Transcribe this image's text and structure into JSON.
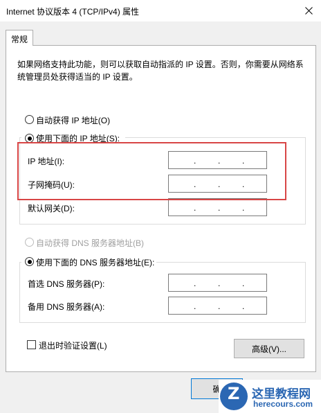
{
  "window": {
    "title": "Internet 协议版本 4 (TCP/IPv4) 属性"
  },
  "tabs": [
    {
      "label": "常规",
      "selected": true
    }
  ],
  "description": "如果网络支持此功能，则可以获取自动指派的 IP 设置。否则，你需要从网络系统管理员处获得适当的 IP 设置。",
  "ip_section": {
    "auto_option": {
      "label": "自动获得 IP 地址(O)",
      "selected": false
    },
    "manual_option": {
      "label": "使用下面的 IP 地址(S):",
      "selected": true
    },
    "fields": [
      {
        "label": "IP 地址(I):",
        "value": ". . ."
      },
      {
        "label": "子网掩码(U):",
        "value": ". . ."
      },
      {
        "label": "默认网关(D):",
        "value": ". . ."
      }
    ]
  },
  "dns_section": {
    "auto_option": {
      "label": "自动获得 DNS 服务器地址(B)",
      "selected": false,
      "disabled": true
    },
    "manual_option": {
      "label": "使用下面的 DNS 服务器地址(E):",
      "selected": true
    },
    "fields": [
      {
        "label": "首选 DNS 服务器(P):",
        "value": ". . ."
      },
      {
        "label": "备用 DNS 服务器(A):",
        "value": ". . ."
      }
    ]
  },
  "validate_checkbox": {
    "label": "退出时验证设置(L)",
    "checked": false
  },
  "buttons": {
    "advanced": "高级(V)...",
    "ok": "确"
  },
  "annotation": {
    "highlight_color": "#d84545"
  },
  "watermark": {
    "title": "这里教程网",
    "url": "herecours.com"
  },
  "colors": {
    "accent": "#0078d7",
    "watermark_blue": "#2b67b3"
  }
}
